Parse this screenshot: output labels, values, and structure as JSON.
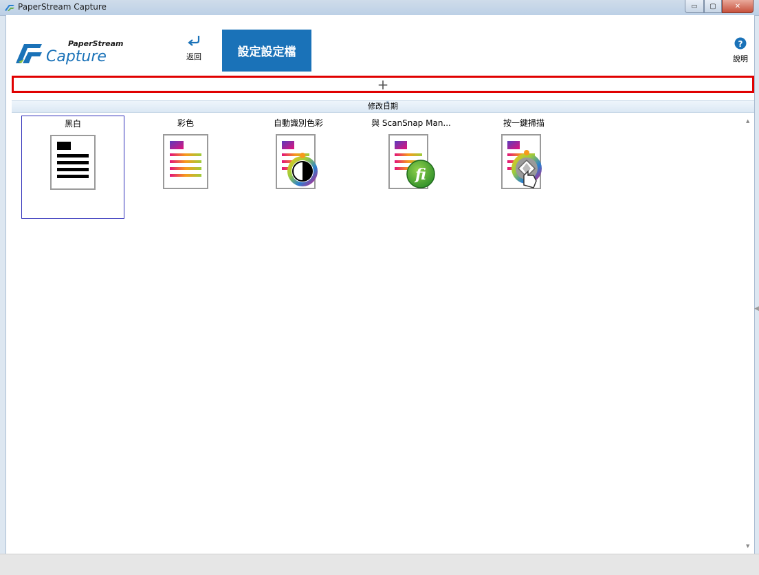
{
  "window": {
    "title": "PaperStream Capture",
    "min_label": "▭",
    "max_label": "▢",
    "close_label": "✕"
  },
  "header": {
    "logo_top": "PaperStream",
    "logo_bottom": "Capture",
    "back_label": "返回",
    "settings_tab": "設定設定檔",
    "help_label": "說明"
  },
  "add_bar": {
    "symbol": "+"
  },
  "sort_bar": {
    "label": "修改日期"
  },
  "profiles": [
    {
      "name": "黑白",
      "icon": "black-white-document-icon",
      "selected": true
    },
    {
      "name": "彩色",
      "icon": "color-document-icon",
      "selected": false
    },
    {
      "name": "自動識別色彩",
      "icon": "auto-color-document-icon",
      "selected": false
    },
    {
      "name": "與 ScanSnap Man...",
      "icon": "scansnap-document-icon",
      "selected": false
    },
    {
      "name": "按一鍵掃描",
      "icon": "one-touch-scan-document-icon",
      "selected": false
    }
  ],
  "colors": {
    "accent": "#1a72b8",
    "highlight": "#e00000",
    "selection": "#2b2bb8"
  }
}
